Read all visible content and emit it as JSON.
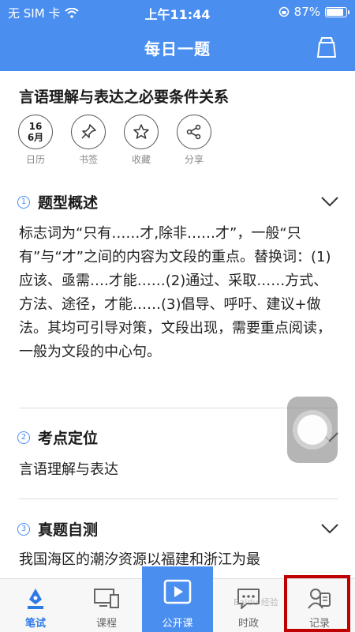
{
  "status_bar": {
    "carrier": "无 SIM 卡",
    "time": "上午11:44",
    "battery": "87%",
    "battery_level": 0.87
  },
  "nav": {
    "title": "每日一题"
  },
  "question": {
    "title": "言语理解与表达之必要条件关系"
  },
  "actions": [
    {
      "date_day": "16",
      "date_month": "6月",
      "label": "日历"
    },
    {
      "label": "书签"
    },
    {
      "label": "收藏"
    },
    {
      "label": "分享"
    }
  ],
  "sections": [
    {
      "num": "1",
      "title": "题型概述",
      "text": "标志词为“只有……才,除非……才”，一般“只有”与“才”之间的内容为文段的重点。替换词：(1)应该、亟需….才能……(2)通过、采取……方式、方法、途径，才能……(3)倡导、呼吁、建议+做法。其均可引导对策，文段出现，需要重点阅读，一般为文段的中心句。"
    },
    {
      "num": "2",
      "title": "考点定位",
      "text": "言语理解与表达"
    },
    {
      "num": "3",
      "title": "真题自测",
      "text": "我国海区的潮汐资源以福建和浙江为最"
    }
  ],
  "tabs": [
    {
      "label": "笔试",
      "icon": "pen-icon"
    },
    {
      "label": "课程",
      "icon": "devices-icon"
    },
    {
      "label": "公开课",
      "icon": "play-icon"
    },
    {
      "label": "时政",
      "icon": "chat-icon"
    },
    {
      "label": "记录",
      "icon": "record-icon"
    }
  ],
  "watermark": "Baidu 经验",
  "colors": {
    "primary": "#4a8ff0",
    "highlight": "#c00000"
  }
}
